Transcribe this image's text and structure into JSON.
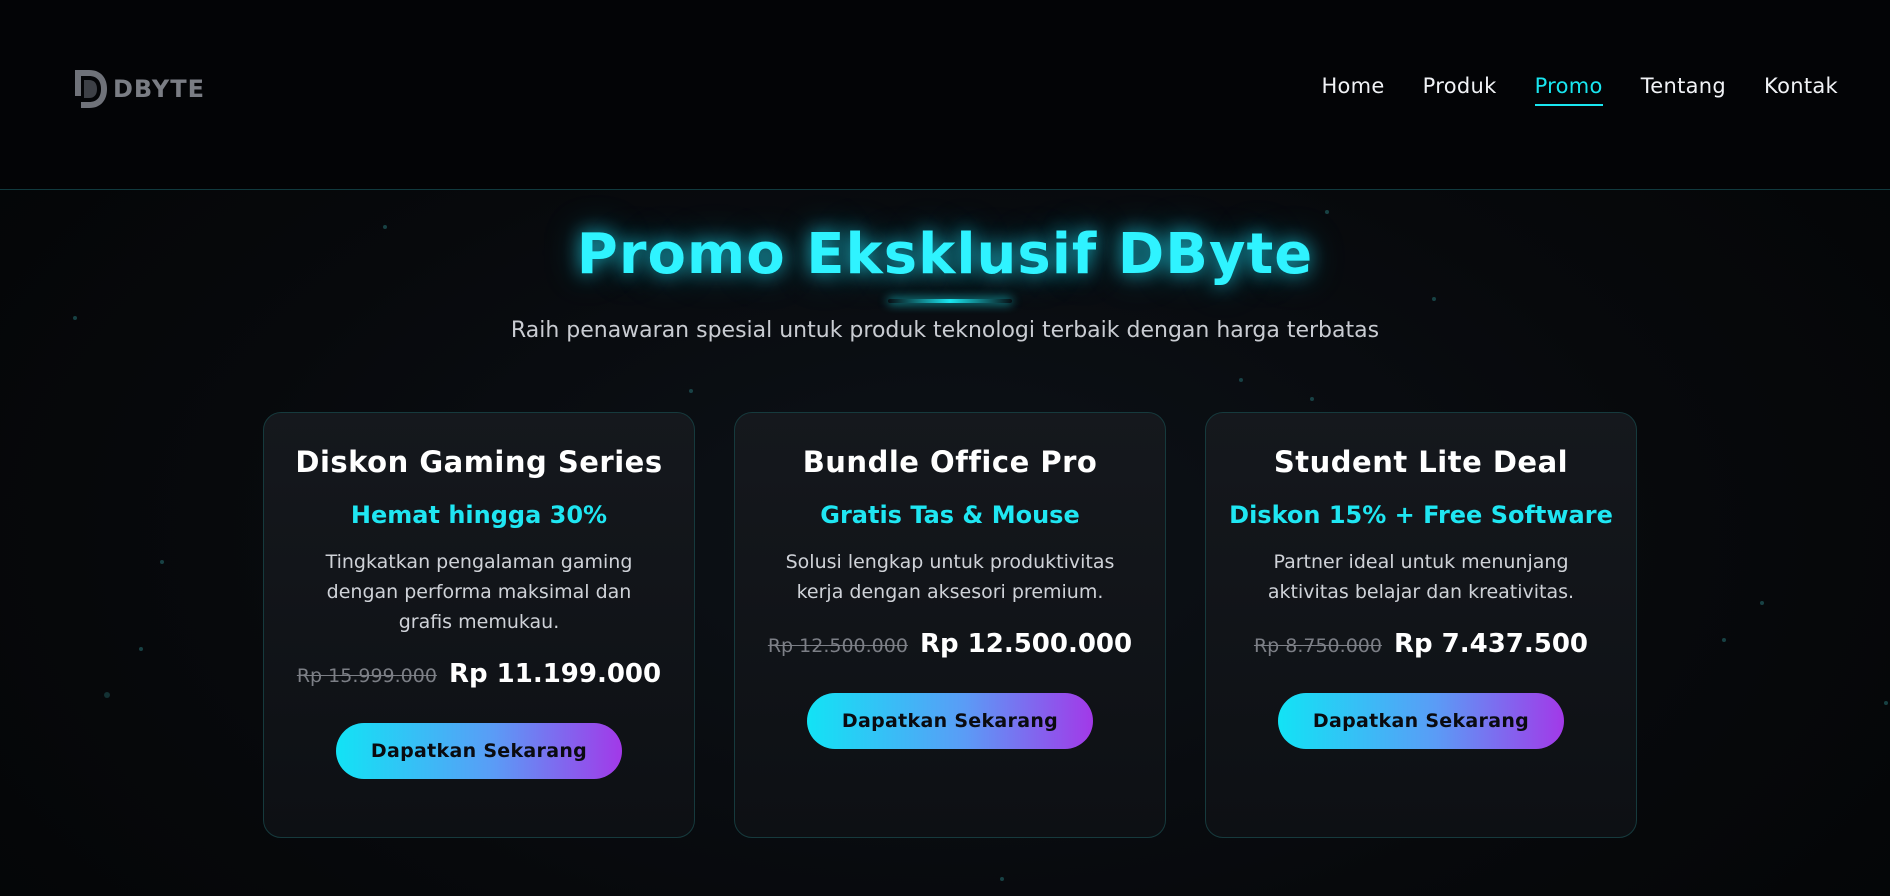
{
  "brand": {
    "logo_text": "DBYTE",
    "accent_color": "#19e6f0"
  },
  "nav": {
    "items": [
      {
        "label": "Home",
        "active": false
      },
      {
        "label": "Produk",
        "active": false
      },
      {
        "label": "Promo",
        "active": true
      },
      {
        "label": "Tentang",
        "active": false
      },
      {
        "label": "Kontak",
        "active": false
      }
    ]
  },
  "hero": {
    "title": "Promo Eksklusif DByte",
    "subtitle": "Raih penawaran spesial untuk produk teknologi terbaik dengan harga terbatas"
  },
  "promos": [
    {
      "title": "Diskon Gaming Series",
      "highlight": "Hemat hingga 30%",
      "description": "Tingkatkan pengalaman gaming dengan performa maksimal dan grafis memukau.",
      "old_price": "Rp 15.999.000",
      "new_price": "Rp 11.199.000",
      "cta": "Dapatkan Sekarang"
    },
    {
      "title": "Bundle Office Pro",
      "highlight": "Gratis Tas & Mouse",
      "description": "Solusi lengkap untuk produktivitas kerja dengan aksesori premium.",
      "old_price": "Rp 12.500.000",
      "new_price": "Rp 12.500.000",
      "cta": "Dapatkan Sekarang"
    },
    {
      "title": "Student Lite Deal",
      "highlight": "Diskon 15% + Free Software",
      "description": "Partner ideal untuk menunjang aktivitas belajar dan kreativitas.",
      "old_price": "Rp 8.750.000",
      "new_price": "Rp 7.437.500",
      "cta": "Dapatkan Sekarang"
    }
  ]
}
